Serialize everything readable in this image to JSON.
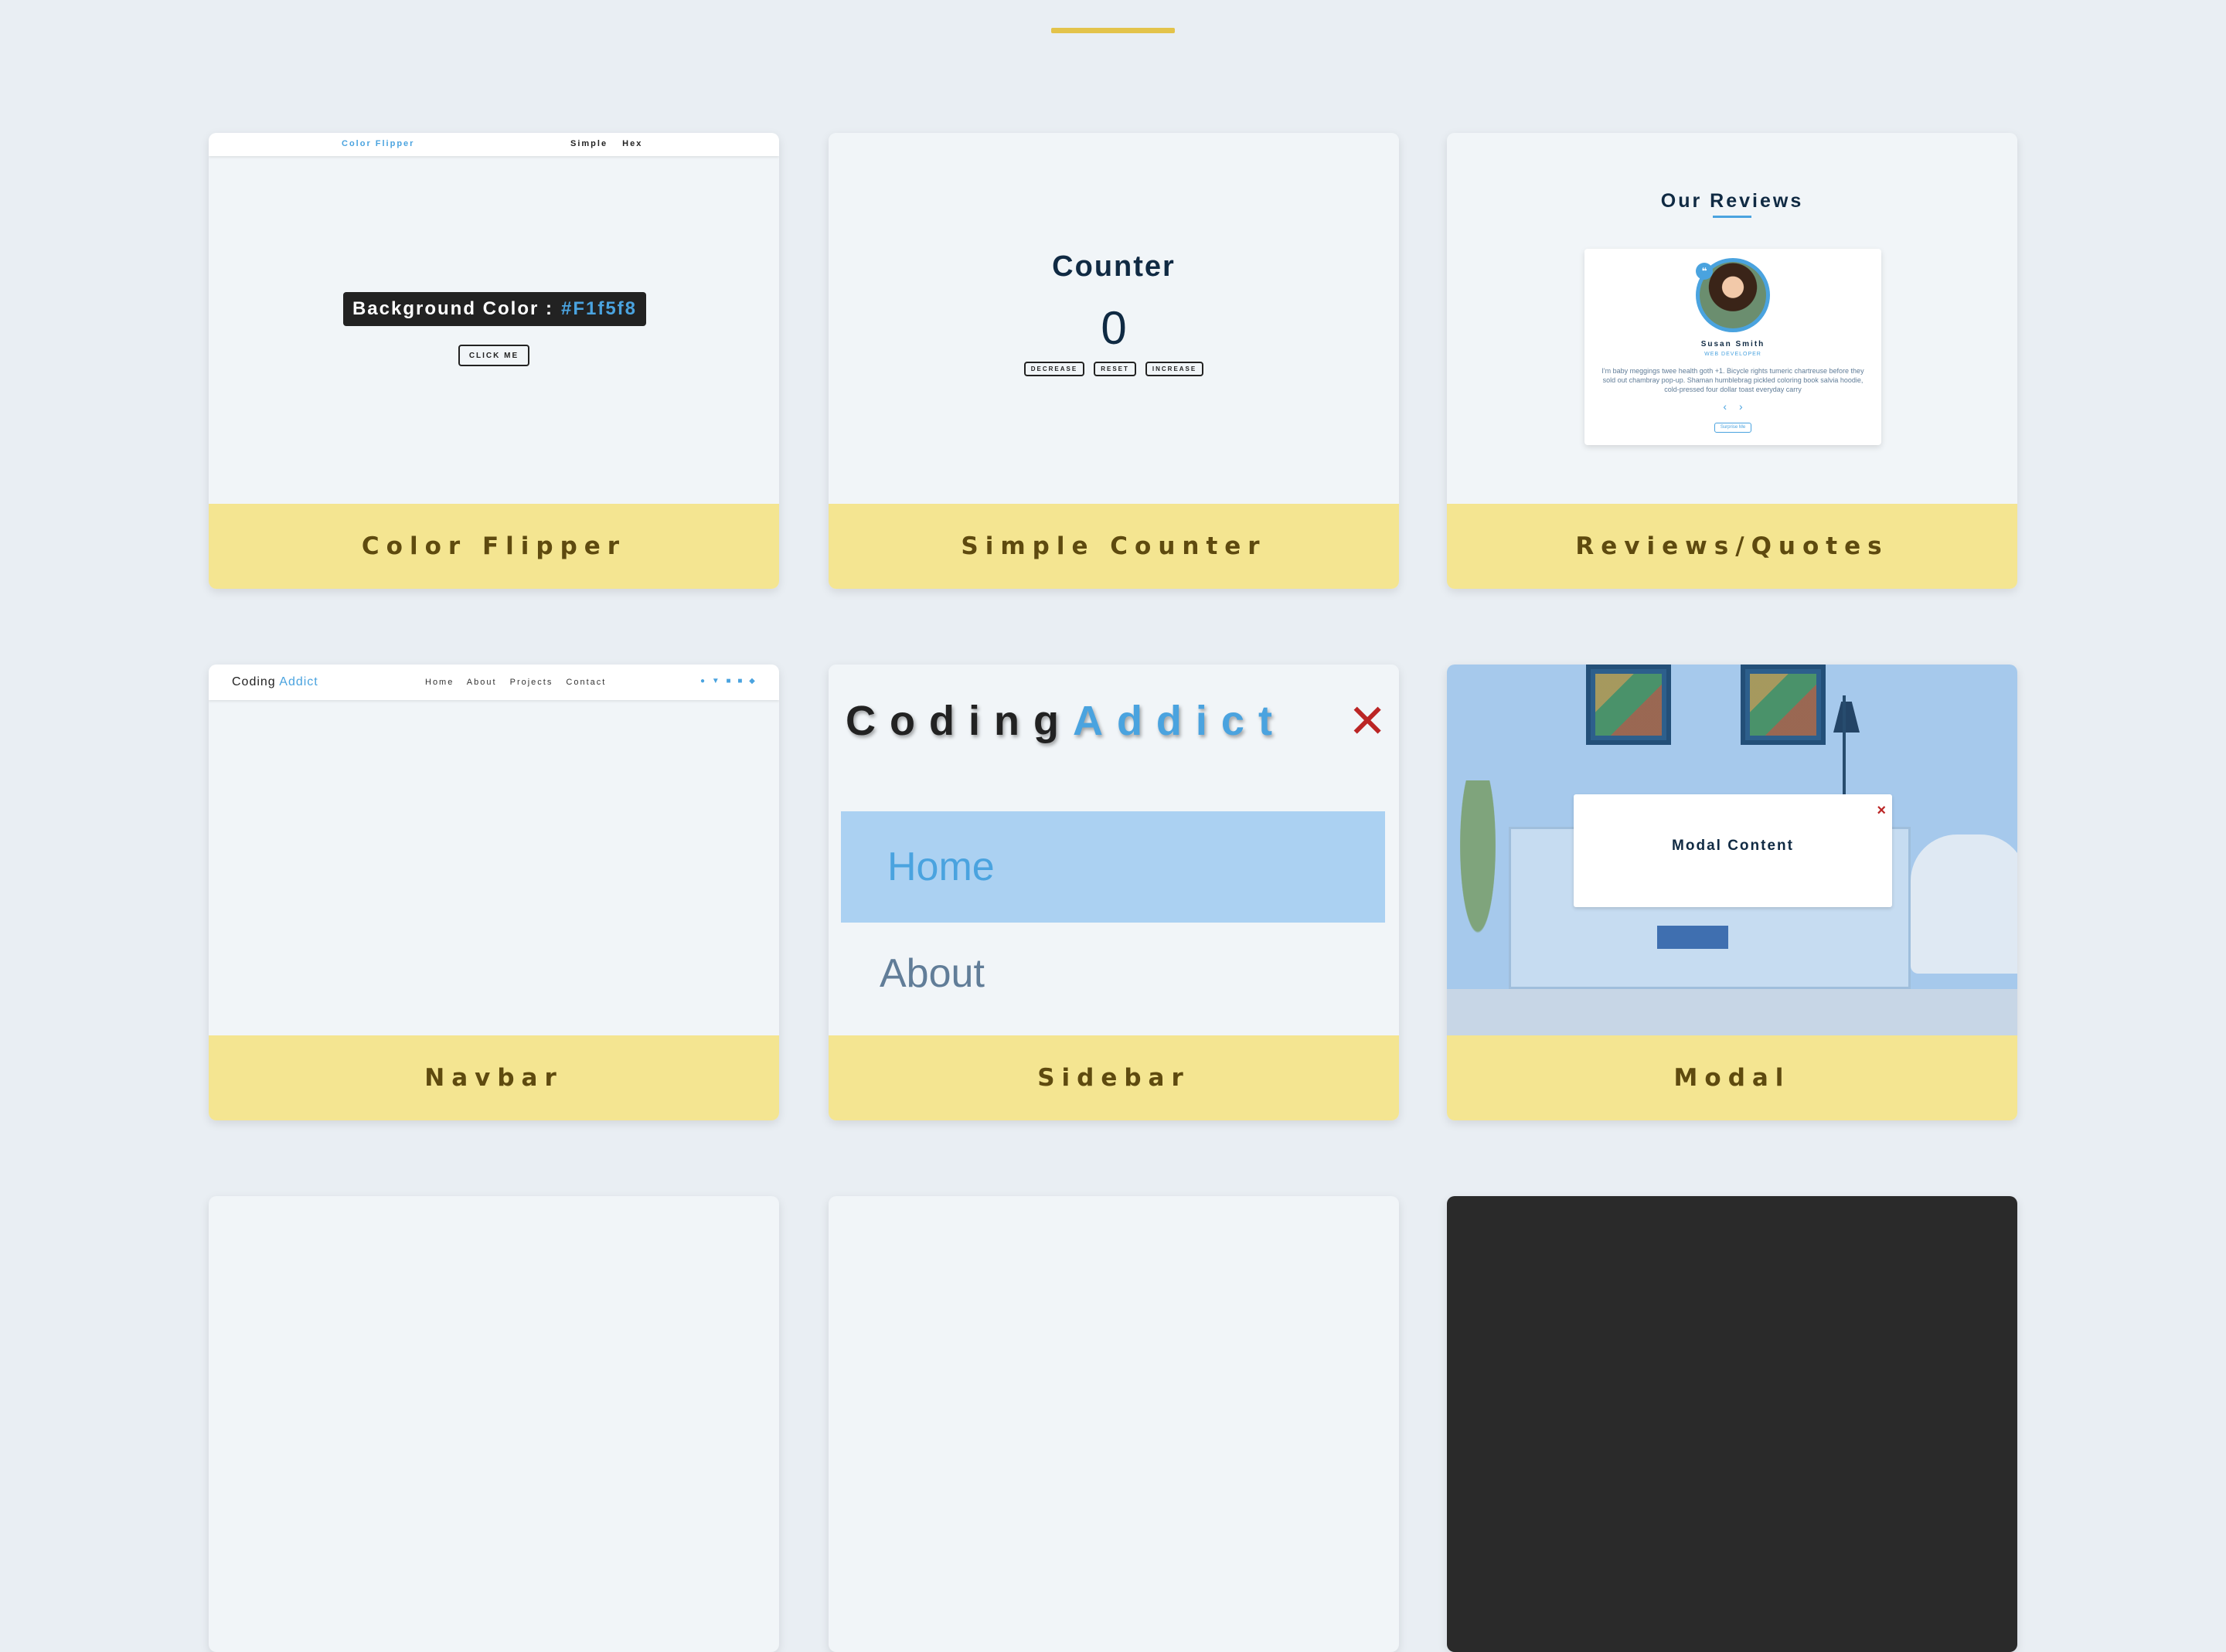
{
  "projects": [
    {
      "footer": "Color Flipper",
      "preview": {
        "nav_brand": "Color Flipper",
        "nav_links": [
          "Simple",
          "Hex"
        ],
        "bg_label": "Background Color :",
        "bg_value": "#F1f5f8",
        "button": "CLICK ME"
      }
    },
    {
      "footer": "Simple Counter",
      "preview": {
        "title": "Counter",
        "value": "0",
        "buttons": [
          "DECREASE",
          "RESET",
          "INCREASE"
        ]
      }
    },
    {
      "footer": "Reviews/Quotes",
      "preview": {
        "title": "Our Reviews",
        "name": "Susan Smith",
        "job": "WEB DEVELOPER",
        "text": "I'm baby meggings twee health goth +1. Bicycle rights tumeric chartreuse before they sold out chambray pop-up. Shaman humblebrag pickled coloring book salvia hoodie, cold-pressed four dollar toast everyday carry",
        "prev": "‹",
        "next": "›",
        "surprise": "Surprise Me"
      }
    },
    {
      "footer": "Navbar",
      "preview": {
        "logo_part1": "Coding",
        "logo_part2": "Addict",
        "links": [
          "Home",
          "About",
          "Projects",
          "Contact"
        ]
      }
    },
    {
      "footer": "Sidebar",
      "preview": {
        "logo_part1": "Coding",
        "logo_part2": "Addict",
        "close": "✕",
        "links": [
          "Home",
          "About"
        ]
      }
    },
    {
      "footer": "Modal",
      "preview": {
        "close": "×",
        "content": "Modal Content"
      }
    }
  ],
  "colors": {
    "footer_bg": "#f4e591",
    "accent": "#4aa3df",
    "danger": "#bb2525"
  }
}
